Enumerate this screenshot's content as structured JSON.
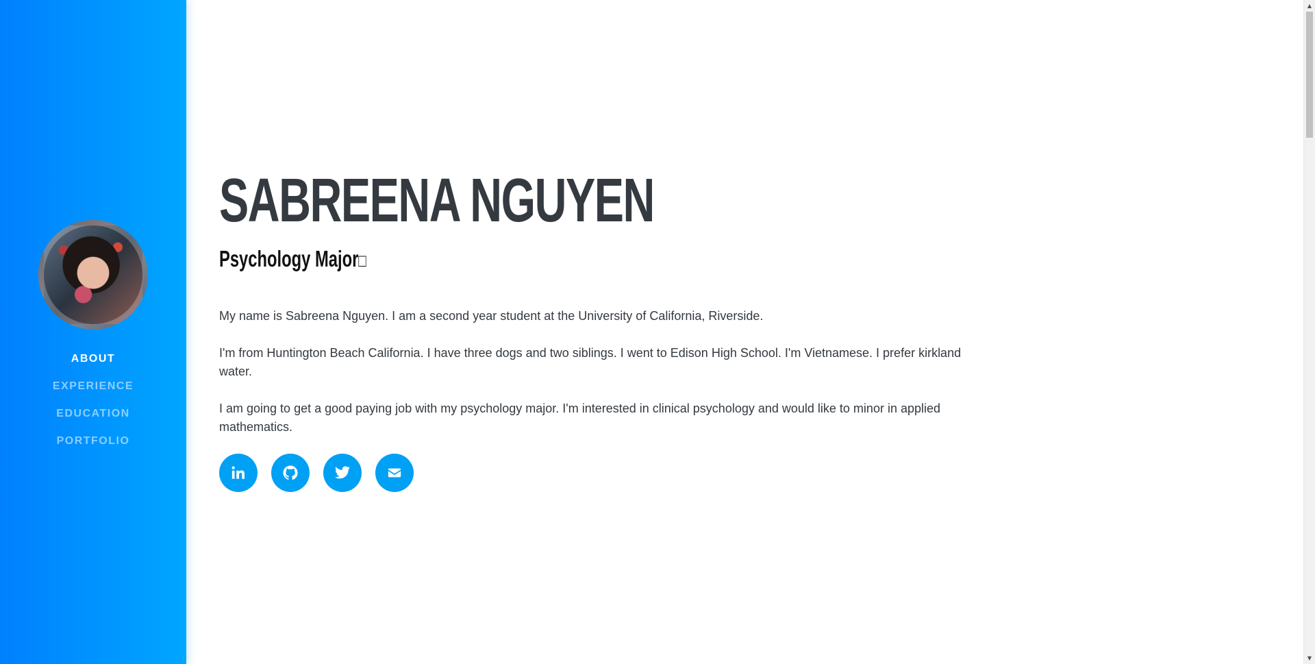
{
  "profile": {
    "name": "SABREENA NGUYEN",
    "subtitle": "Psychology Major",
    "subtitle_glyph": "□"
  },
  "nav": {
    "items": [
      {
        "label": "ABOUT",
        "active": true
      },
      {
        "label": "EXPERIENCE",
        "active": false
      },
      {
        "label": "EDUCATION",
        "active": false
      },
      {
        "label": "PORTFOLIO",
        "active": false
      }
    ]
  },
  "bio": {
    "paragraphs": [
      "My name is Sabreena Nguyen. I am a second year student at the University of California, Riverside.",
      "I'm from Huntington Beach California. I have three dogs and two siblings. I went to Edison High School. I'm Vietnamese. I prefer kirkland water.",
      "I am going to get a good paying job with my psychology major. I'm interested in clinical psychology and would like to minor in applied mathematics."
    ]
  },
  "social": {
    "icons": [
      "linkedin-icon",
      "github-icon",
      "twitter-icon",
      "envelope-icon"
    ]
  },
  "colors": {
    "sidebar_start": "#0080ff",
    "sidebar_end": "#00a6ff",
    "accent": "#00a0f5",
    "heading": "#343a40"
  }
}
